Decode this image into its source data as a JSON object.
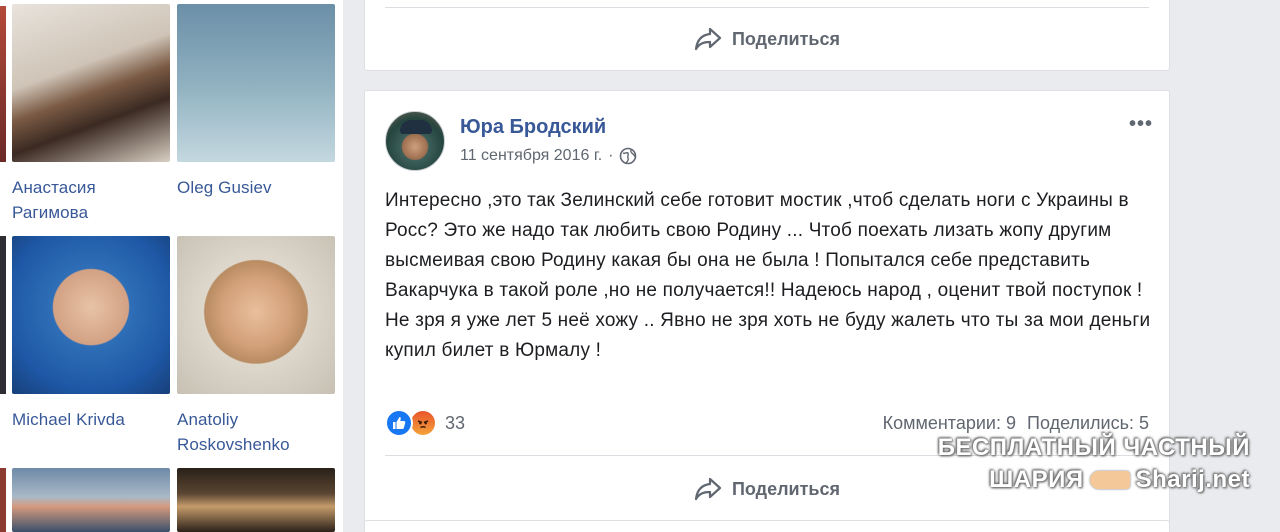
{
  "friends": [
    {
      "name": "Анастасия Рагимова"
    },
    {
      "name": "Oleg Gusiev"
    },
    {
      "name": "Michael Krivda"
    },
    {
      "name": "Anatoliy Roskovshenko"
    }
  ],
  "prev_post": {
    "share_label": "Поделиться"
  },
  "post": {
    "author": "Юра Бродский",
    "date": "11 сентября 2016 г.",
    "separator": "·",
    "more": "•••",
    "text": "Интересно ,это так Зелинский себе готовит мостик ,чтоб сделать ноги с Украины в Росс? Это же надо так любить свою Родину ... Чтоб поехать лизать жопу другим высмеивая свою Родину какая бы она не была ! Попытался себе представить Вакарчука в такой роле ,но не получается!! Надеюсь народ , оценит твой поступок ! Не зря я уже лет 5 неё хожу .. Явно не зря хоть не буду жалеть что ты за мои деньги купил билет в Юрмалу !",
    "reaction_count": "33",
    "comments": "Комментарии: 9",
    "shares": "Поделились: 5",
    "share_label": "Поделиться"
  },
  "watermark": {
    "line1": "БЕСПЛАТНЫЙ ЧАСТНЫЙ",
    "line2a": "ШАРИЯ",
    "line2b": "Sharij.net"
  },
  "colors": {
    "link": "#385898",
    "secondary": "#606770",
    "like": "#1877f2"
  }
}
